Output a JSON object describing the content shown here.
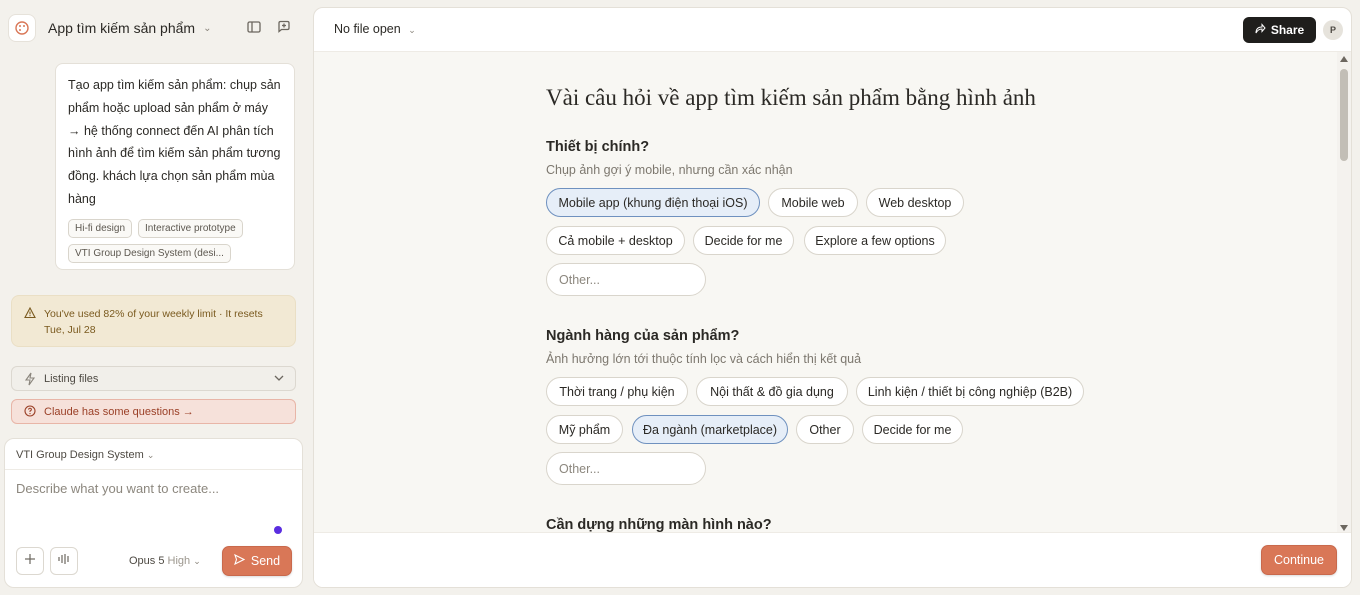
{
  "app": {
    "title": "App tìm kiếm sản phẩm"
  },
  "message": {
    "text": "Tạo app tìm kiếm sản phẩm: chụp sản phẩm hoặc upload sản phẩm ở máy → hệ thống connect đến AI phân tích hình ảnh để tìm kiếm sản phẩm tương đồng. khách lựa chọn sản phẩm mùa hàng",
    "chips": [
      "Hi-fi design",
      "Interactive prototype",
      "VTI Group Design System (desi..."
    ]
  },
  "limit_notice": "You've used 82% of your weekly limit · It resets Tue, Jul 28",
  "listing": {
    "label": "Listing files"
  },
  "questions_banner": "Claude has some questions →",
  "composer": {
    "design_system": "VTI Group Design System",
    "placeholder": "Describe what you want to create...",
    "model": "Opus 5",
    "effort": "High",
    "send_label": "Send"
  },
  "topbar": {
    "file_label": "No file open",
    "share_label": "Share",
    "avatar_initial": "P"
  },
  "form": {
    "title": "Vài câu hỏi về app tìm kiếm sản phẩm bằng hình ảnh",
    "questions": [
      {
        "title": "Thiết bị chính?",
        "hint": "Chụp ảnh gợi ý mobile, nhưng cần xác nhận",
        "options": [
          {
            "label": "Mobile app (khung điện thoại iOS)",
            "selected": true
          },
          {
            "label": "Mobile web",
            "selected": false
          },
          {
            "label": "Web desktop",
            "selected": false
          },
          {
            "label": "Cả mobile + desktop",
            "selected": false
          },
          {
            "label": "Decide for me",
            "selected": false
          },
          {
            "label": "Explore a few options",
            "selected": false
          }
        ],
        "other_placeholder": "Other..."
      },
      {
        "title": "Ngành hàng của sản phẩm?",
        "hint": "Ảnh hưởng lớn tới thuộc tính lọc và cách hiển thị kết quả",
        "options": [
          {
            "label": "Thời trang / phụ kiện",
            "selected": false
          },
          {
            "label": "Nội thất & đồ gia dụng",
            "selected": false
          },
          {
            "label": "Linh kiện / thiết bị công nghiệp (B2B)",
            "selected": false
          },
          {
            "label": "Mỹ phẩm",
            "selected": false
          },
          {
            "label": "Đa ngành (marketplace)",
            "selected": true
          },
          {
            "label": "Other",
            "selected": false
          },
          {
            "label": "Decide for me",
            "selected": false
          }
        ],
        "other_placeholder": "Other..."
      },
      {
        "title": "Cần dựng những màn hình nào?"
      }
    ],
    "continue_label": "Continue"
  },
  "colors": {
    "accent": "#d97757",
    "selected_bg": "#e6eef8",
    "selected_border": "#6f91bf",
    "warning_bg": "#f2e9d4",
    "question_bg": "#f6e1da"
  }
}
